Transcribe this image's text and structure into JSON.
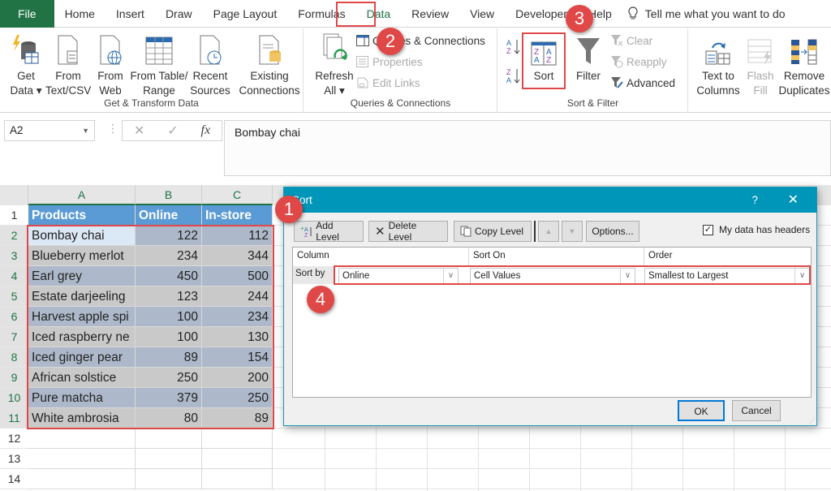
{
  "tabs": [
    "File",
    "Home",
    "Insert",
    "Draw",
    "Page Layout",
    "Formulas",
    "Data",
    "Review",
    "View",
    "Developer",
    "Help"
  ],
  "tell_me": "Tell me what you want to do",
  "ribbon": {
    "get_transform": {
      "label": "Get & Transform Data",
      "buttons": [
        {
          "line1": "Get",
          "line2": "Data ▾"
        },
        {
          "line1": "From",
          "line2": "Text/CSV"
        },
        {
          "line1": "From",
          "line2": "Web"
        },
        {
          "line1": "From Table/",
          "line2": "Range"
        },
        {
          "line1": "Recent",
          "line2": "Sources"
        },
        {
          "line1": "Existing",
          "line2": "Connections"
        }
      ]
    },
    "queries": {
      "label": "Queries & Connections",
      "refresh": {
        "line1": "Refresh",
        "line2": "All ▾"
      },
      "items": [
        "Queries & Connections",
        "Properties",
        "Edit Links"
      ]
    },
    "sort_filter": {
      "label": "Sort & Filter",
      "sort": "Sort",
      "filter": "Filter",
      "clear": "Clear",
      "reapply": "Reapply",
      "advanced": "Advanced"
    },
    "data_tools": {
      "text_to_columns": {
        "line1": "Text to",
        "line2": "Columns"
      },
      "flash_fill": {
        "line1": "Flash",
        "line2": "Fill"
      },
      "remove_duplicates": {
        "line1": "Remove",
        "line2": "Duplicates"
      }
    }
  },
  "formula_bar": {
    "name_box": "A2",
    "value": "Bombay chai"
  },
  "sheet": {
    "columns": [
      "A",
      "B",
      "C"
    ],
    "headers": [
      "Products",
      "Online",
      "In-store"
    ],
    "rows": [
      [
        "Bombay chai",
        "122",
        "112"
      ],
      [
        "Blueberry merlot",
        "234",
        "344"
      ],
      [
        "Earl grey",
        "450",
        "500"
      ],
      [
        "Estate darjeeling",
        "123",
        "244"
      ],
      [
        "Harvest apple spi",
        "100",
        "234"
      ],
      [
        "Iced raspberry ne",
        "100",
        "130"
      ],
      [
        "Iced ginger pear",
        "89",
        "154"
      ],
      [
        "African solstice",
        "250",
        "200"
      ],
      [
        "Pure matcha",
        "379",
        "250"
      ],
      [
        "White ambrosia",
        "80",
        "89"
      ]
    ],
    "row_numbers": [
      "1",
      "2",
      "3",
      "4",
      "5",
      "6",
      "7",
      "8",
      "9",
      "10",
      "11",
      "12",
      "13",
      "14"
    ]
  },
  "dialog": {
    "title": "Sort",
    "help": "?",
    "close": "✕",
    "add_level": "Add Level",
    "delete_level": "Delete Level",
    "copy_level": "Copy Level",
    "options": "Options...",
    "headers_checkbox": "My data has headers",
    "col_column": "Column",
    "col_sort_on": "Sort On",
    "col_order": "Order",
    "sort_by": "Sort by",
    "column_value": "Online",
    "sort_on_value": "Cell Values",
    "order_value": "Smallest to Largest",
    "ok": "OK",
    "cancel": "Cancel"
  },
  "badges": [
    "1",
    "2",
    "3",
    "4"
  ],
  "colors": {
    "accent": "#217346",
    "header_fill": "#5b9bd5",
    "badge": "#e04848",
    "dialog_title": "#0096ba"
  }
}
